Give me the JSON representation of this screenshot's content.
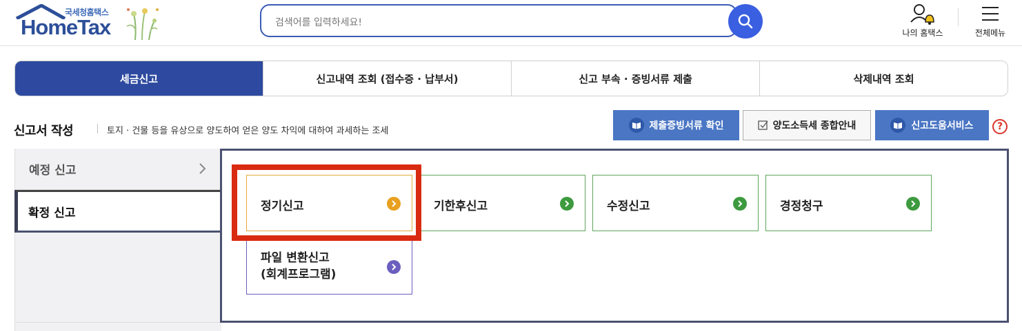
{
  "header": {
    "logo_sub": "국세청홈택스",
    "logo_main": "HomeTax",
    "search_placeholder": "검색어를 입력하세요!",
    "my_hometax_label": "나의 홈택스",
    "all_menu_label": "전체메뉴"
  },
  "tabs": [
    {
      "label": "세금신고",
      "active": true
    },
    {
      "label": "신고내역 조회 (접수증 · 납부서)",
      "active": false
    },
    {
      "label": "신고 부속 · 증빙서류 제출",
      "active": false
    },
    {
      "label": "삭제내역 조회",
      "active": false
    }
  ],
  "section": {
    "title": "신고서 작성",
    "description": "토지 · 건물 등을 유상으로 양도하여 얻은 양도 차익에 대하여 과세하는 조세",
    "buttons": {
      "evidence_check": "제출증빙서류 확인",
      "guide": "양도소득세 종합안내",
      "help_service": "신고도움서비스"
    },
    "help_icon": "?"
  },
  "side_menu": {
    "items": [
      {
        "label": "예정 신고",
        "active": false
      },
      {
        "label": "확정 신고",
        "active": true
      }
    ]
  },
  "cards": [
    {
      "label": "정기신고",
      "selected": true
    },
    {
      "label": "기한후신고",
      "selected": false
    },
    {
      "label": "수정신고",
      "selected": false
    },
    {
      "label": "경정청구",
      "selected": false
    },
    {
      "label_line1": "파일 변환신고",
      "label_line2": "(회계프로그램)",
      "selected": false
    }
  ],
  "colors": {
    "primary_navy": "#2e4aa0",
    "button_blue": "#4a76c4",
    "card_green": "#5ea55a",
    "arrow_green": "#3d9a3f",
    "arrow_orange": "#e8a020",
    "arrow_purple": "#6a5fbf",
    "highlight_red": "#d92b12"
  }
}
